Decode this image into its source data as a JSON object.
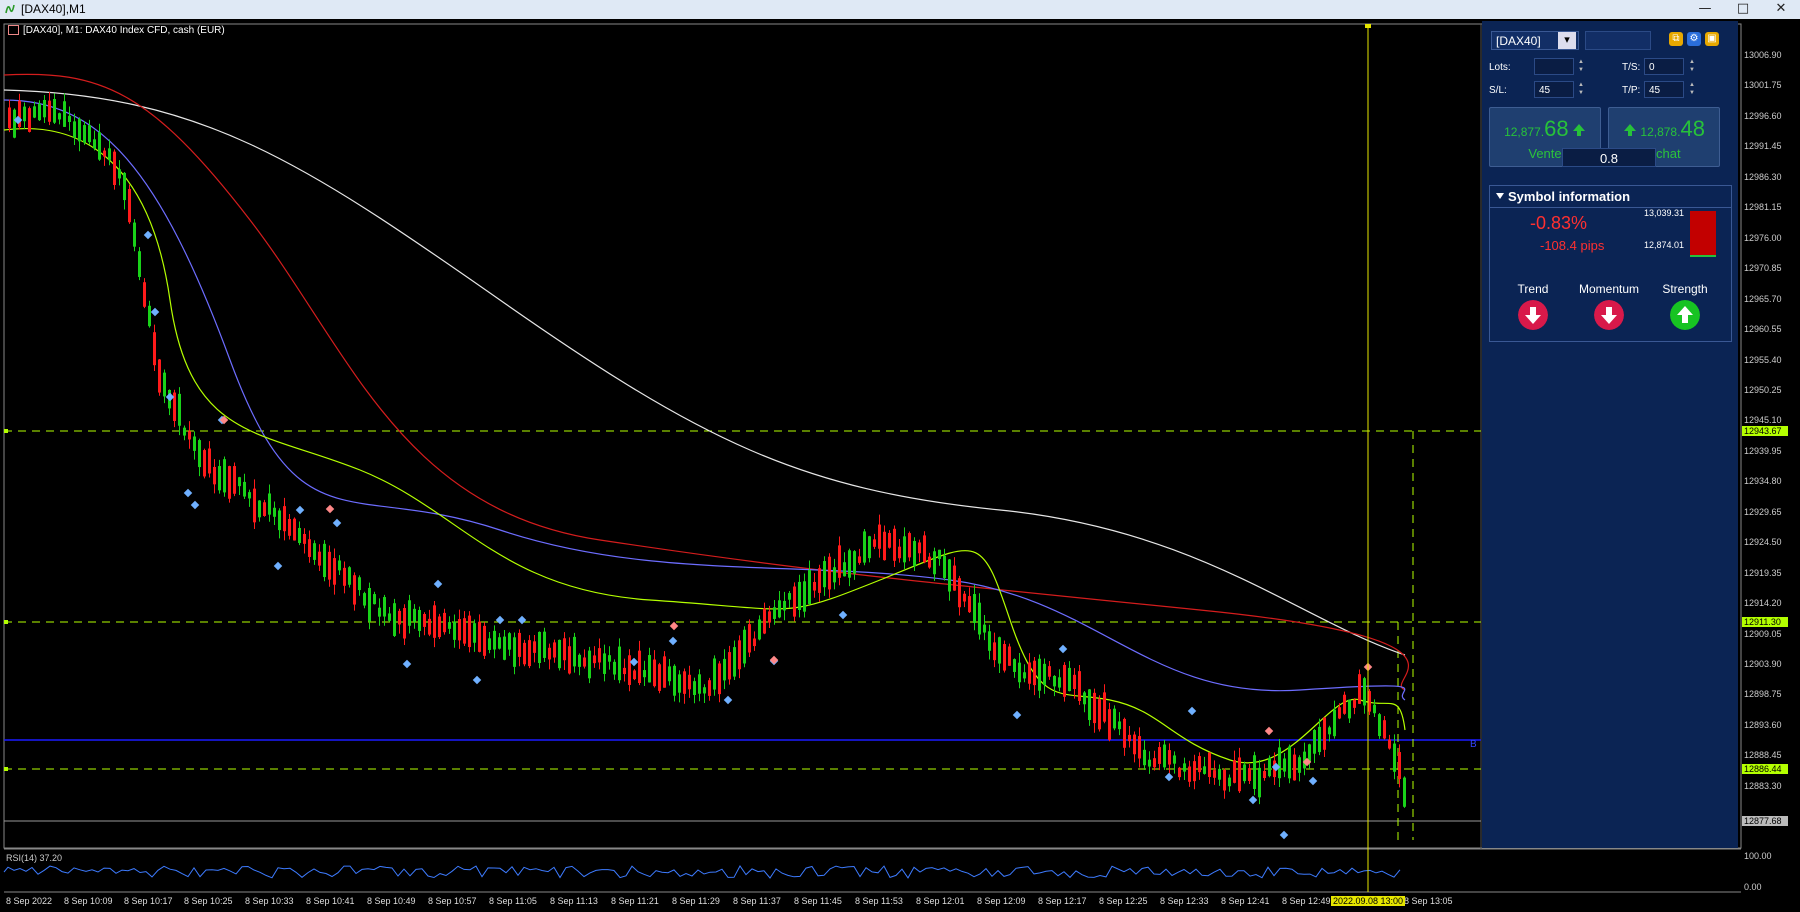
{
  "window": {
    "title": "[DAX40],M1",
    "minimize": "—",
    "maximize": "□",
    "close": "✕"
  },
  "chart": {
    "header": "[DAX40], M1:  DAX40 Index CFD, cash (EUR)",
    "colors": {
      "bull": "#19d219",
      "bear": "#ff1a1a",
      "ma_white": "#e6e6e6",
      "ma_red": "#d41d1d",
      "ma_blue": "#6d6dff",
      "ma_green": "#b4ff00",
      "level_line": "#b4ff00",
      "blue_line": "#1a1aff",
      "rsi": "#3d7bff"
    },
    "price_axis": [
      "13006.90",
      "13001.75",
      "12996.60",
      "12991.45",
      "12986.30",
      "12981.15",
      "12976.00",
      "12970.85",
      "12965.70",
      "12960.55",
      "12955.40",
      "12950.25",
      "12945.10",
      "12939.95",
      "12934.80",
      "12929.65",
      "12924.50",
      "12919.35",
      "12914.20",
      "12909.05",
      "12903.90",
      "12898.75",
      "12893.60",
      "12888.45",
      "12883.30"
    ],
    "price_tags": {
      "upper": "12943.67",
      "middle": "12911.30",
      "lower": "12886.44",
      "current": "12877.68"
    },
    "time_axis": [
      "8 Sep 2022",
      "8 Sep 10:09",
      "8 Sep 10:17",
      "8 Sep 10:25",
      "8 Sep 10:33",
      "8 Sep 10:41",
      "8 Sep 10:49",
      "8 Sep 10:57",
      "8 Sep 11:05",
      "8 Sep 11:13",
      "8 Sep 11:21",
      "8 Sep 11:29",
      "8 Sep 11:37",
      "8 Sep 11:45",
      "8 Sep 11:53",
      "8 Sep 12:01",
      "8 Sep 12:09",
      "8 Sep 12:17",
      "8 Sep 12:25",
      "8 Sep 12:33",
      "8 Sep 12:41",
      "8 Sep 12:49",
      "8 Sep 13:05"
    ],
    "crosshair_time": "2022.09.08 13:00",
    "rsi_label": "RSI(14) 37.20",
    "rsi_axis": [
      "100.00",
      "0.00"
    ],
    "blue_line_label": "B"
  },
  "panel": {
    "symbol": "[DAX40]",
    "lots_label": "Lots:",
    "lots_value": "",
    "ts_label": "T/S:",
    "ts_value": "0",
    "sl_label": "S/L:",
    "sl_value": "45",
    "tp_label": "T/P:",
    "tp_value": "45",
    "sell": {
      "price_prefix": "12,877.",
      "price_big": "68",
      "label": "Vente"
    },
    "buy": {
      "price_prefix": "12,878.",
      "price_big": "48",
      "label": "Achat"
    },
    "spread": "0.8",
    "info": {
      "title": "Symbol information",
      "change_pct": "-0.83%",
      "change_pips": "-108.4 pips",
      "high": "13,039.31",
      "low": "12,874.01",
      "trend": "Trend",
      "momentum": "Momentum",
      "strength": "Strength"
    }
  }
}
